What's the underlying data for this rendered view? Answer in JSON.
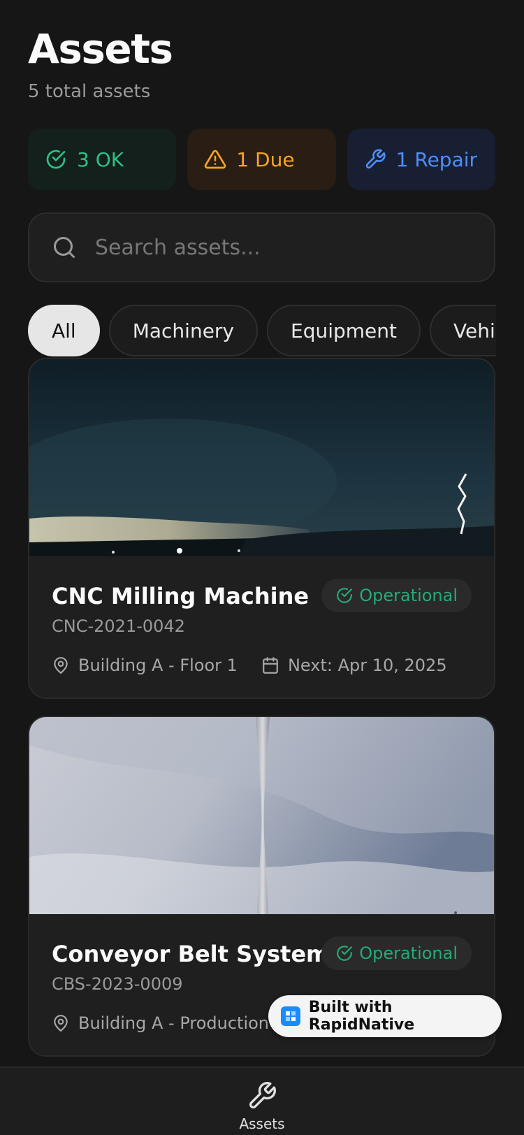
{
  "header": {
    "title": "Assets",
    "subtitle": "5 total assets"
  },
  "stats": {
    "ok": {
      "label": "3 OK",
      "icon": "check-circle-icon",
      "color": "#2fbf86"
    },
    "due": {
      "label": "1 Due",
      "icon": "warning-triangle-icon",
      "color": "#f5a623"
    },
    "repair": {
      "label": "1 Repair",
      "icon": "wrench-icon",
      "color": "#4f8ef7"
    }
  },
  "search": {
    "placeholder": "Search assets...",
    "value": ""
  },
  "filters": [
    "All",
    "Machinery",
    "Equipment",
    "Vehicl"
  ],
  "active_filter": "All",
  "assets": [
    {
      "name": "CNC Milling Machine",
      "code": "CNC-2021-0042",
      "status": "Operational",
      "location": "Building A - Floor 1",
      "next": "Next: Apr 10, 2025"
    },
    {
      "name": "Conveyor Belt System",
      "code": "CBS-2023-0009",
      "status": "Operational",
      "location": "Building A - Production L"
    }
  ],
  "built_with": "Built with RapidNative",
  "tabbar": {
    "assets_label": "Assets"
  },
  "colors": {
    "background": "#161616",
    "card": "#1f1f1f",
    "operational": "#27a978"
  }
}
